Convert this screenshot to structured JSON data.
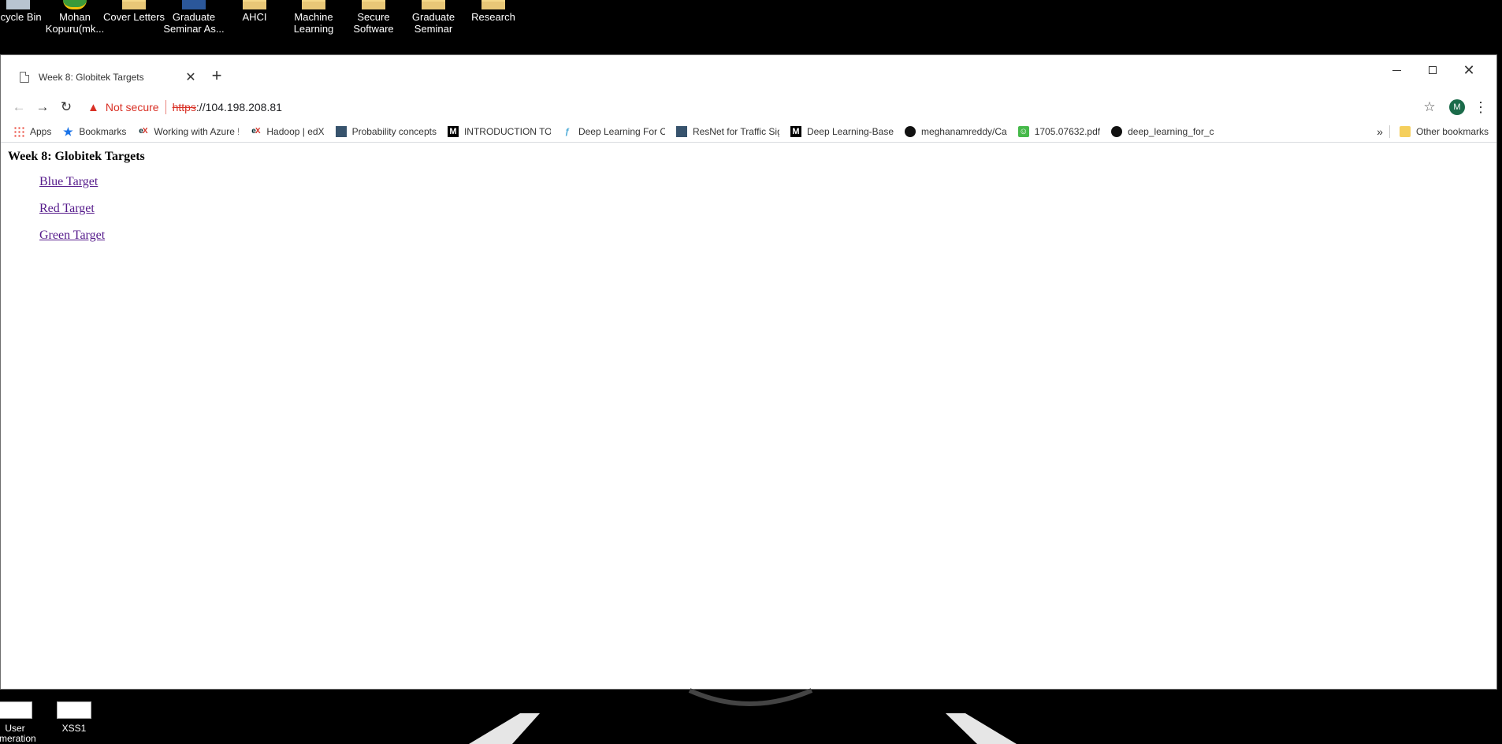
{
  "desktop": {
    "icons": [
      {
        "label": "ecycle Bin"
      },
      {
        "label": "Mohan\nKopuru(mk..."
      },
      {
        "label": "Cover Letters"
      },
      {
        "label": "Graduate\nSeminar As..."
      },
      {
        "label": "AHCI"
      },
      {
        "label": "Machine\nLearning"
      },
      {
        "label": "Secure\nSoftware"
      },
      {
        "label": "Graduate\nSeminar"
      },
      {
        "label": "Research"
      }
    ],
    "bottom_icons": [
      {
        "label": "User\numeration"
      },
      {
        "label": "XSS1"
      }
    ]
  },
  "browser": {
    "tab_title": "Week 8: Globitek Targets",
    "tab_close": "✕",
    "new_tab": "+",
    "window_controls": {
      "close": "✕"
    },
    "nav": {
      "back": "←",
      "forward": "→",
      "reload": "↻"
    },
    "omnibox": {
      "warning_icon": "▲",
      "security_label": "Not secure",
      "url_scheme": "https",
      "url_rest": "://104.198.208.81"
    },
    "star": "☆",
    "avatar_letter": "M",
    "menu": "⋮",
    "bookmarks": [
      {
        "label": "Apps",
        "icon": "apps-icon"
      },
      {
        "label": "Bookmarks",
        "icon": "star-icon"
      },
      {
        "label": "Working with Azure !",
        "icon": "edx-icon"
      },
      {
        "label": "Hadoop | edX",
        "icon": "edx-icon"
      },
      {
        "label": "Probability concepts",
        "icon": "doc-icon"
      },
      {
        "label": "INTRODUCTION TO (",
        "icon": "medium-icon"
      },
      {
        "label": "Deep Learning For C",
        "icon": "deeplearning-icon"
      },
      {
        "label": "ResNet for Traffic Sig",
        "icon": "doc-icon"
      },
      {
        "label": "Deep Learning-Base",
        "icon": "medium-icon"
      },
      {
        "label": "meghanamreddy/Ca",
        "icon": "github-icon"
      },
      {
        "label": "1705.07632.pdf",
        "icon": "pdf-icon"
      },
      {
        "label": "deep_learning_for_c",
        "icon": "github-icon"
      }
    ],
    "bookmarks_more": "»",
    "other_bookmarks": "Other bookmarks"
  },
  "page": {
    "heading": "Week 8: Globitek Targets",
    "links": [
      {
        "label": "Blue Target"
      },
      {
        "label": "Red Target"
      },
      {
        "label": "Green Target"
      }
    ]
  }
}
